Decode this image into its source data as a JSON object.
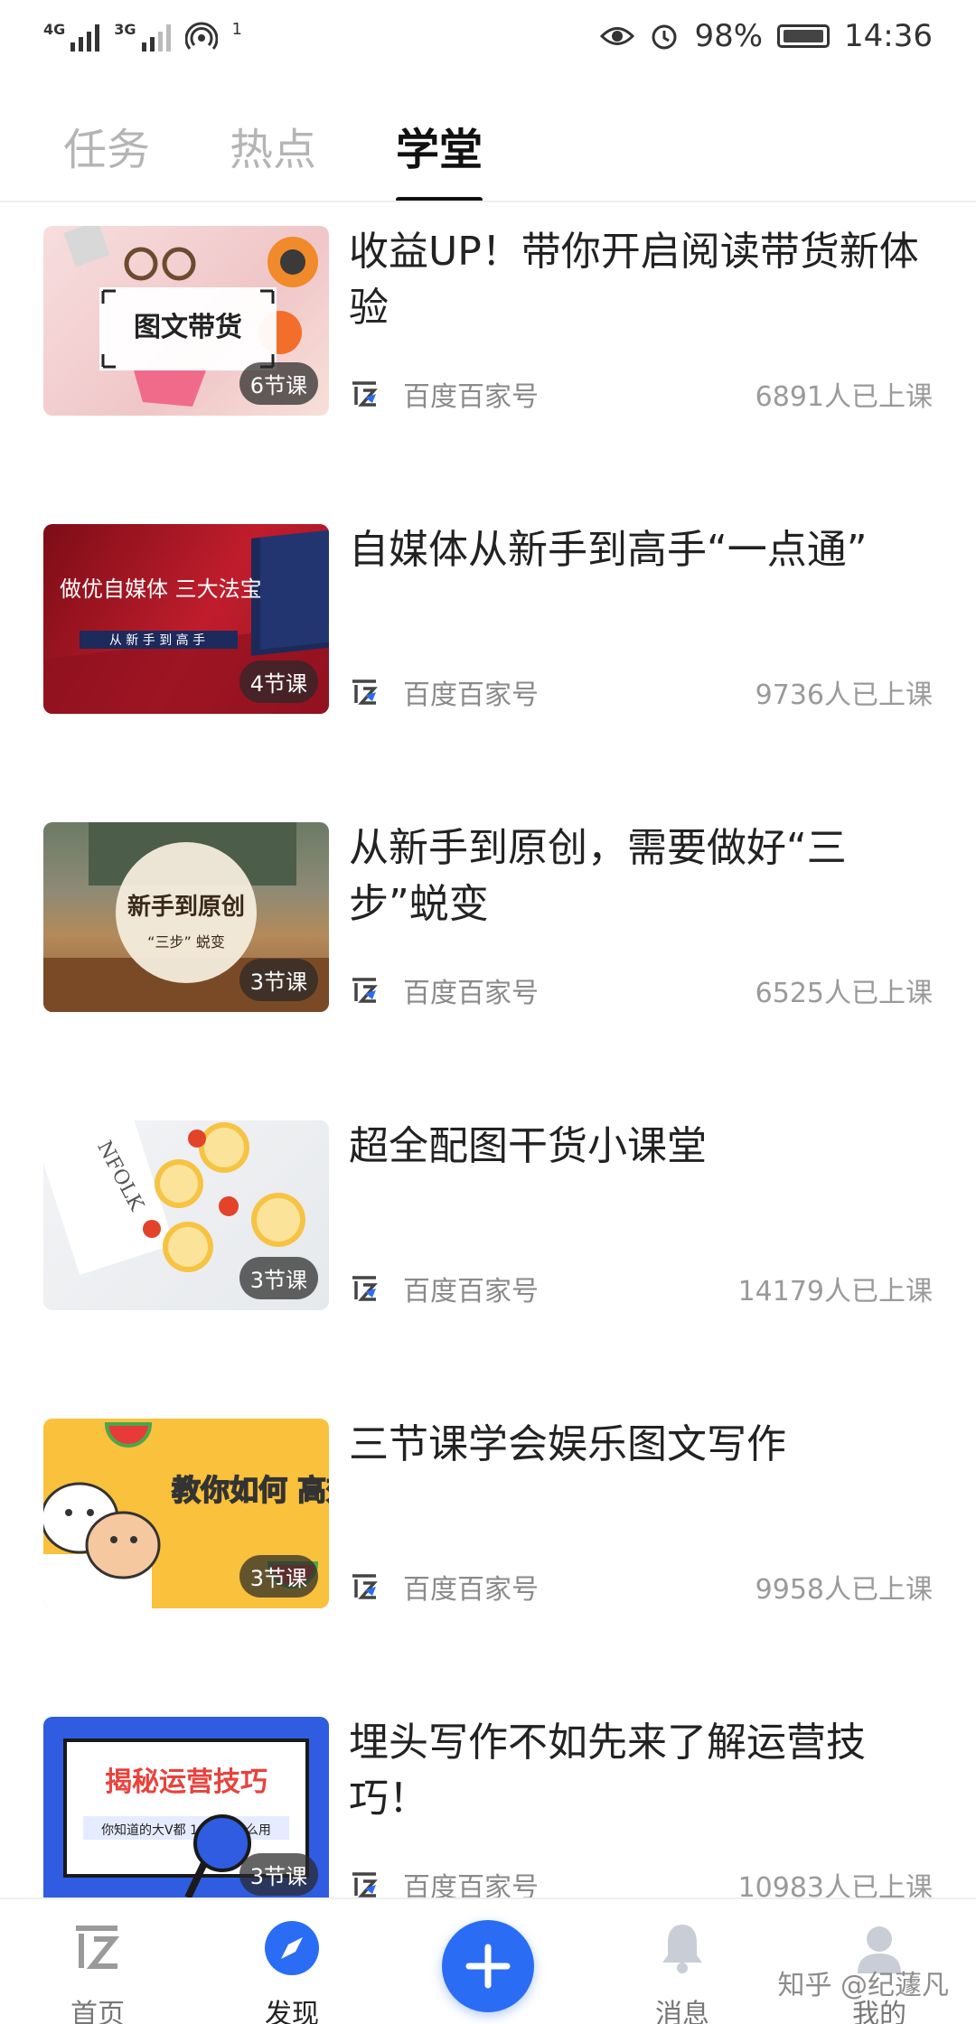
{
  "status_bar": {
    "net1": "4G",
    "net2": "3G",
    "hotspot_count": "1",
    "battery_percent": "98%",
    "time": "14:36"
  },
  "tabs": [
    {
      "label": "任务",
      "active": false
    },
    {
      "label": "热点",
      "active": false
    },
    {
      "label": "学堂",
      "active": true
    }
  ],
  "courses": [
    {
      "title": "收益UP！带你开启阅读带货新体验",
      "thumb_text": "图文带货",
      "thumb_subtext": "",
      "lessons": "6节课",
      "publisher": "百度百家号",
      "learners": "6891人已上课"
    },
    {
      "title": "自媒体从新手到高手“一点通”",
      "thumb_text": "做优自媒体 三大法宝",
      "thumb_subtext": "从 新 手 到 高 手",
      "lessons": "4节课",
      "publisher": "百度百家号",
      "learners": "9736人已上课"
    },
    {
      "title": "从新手到原创，需要做好“三步”蜕变",
      "thumb_text": "新手到原创",
      "thumb_subtext": "“三步” 蜕变",
      "lessons": "3节课",
      "publisher": "百度百家号",
      "learners": "6525人已上课"
    },
    {
      "title": "超全配图干货小课堂",
      "thumb_text": "NFOLK",
      "thumb_subtext": "",
      "lessons": "3节课",
      "publisher": "百度百家号",
      "learners": "14179人已上课"
    },
    {
      "title": "三节课学会娱乐图文写作",
      "thumb_text": "教你如何 高效吃瓜",
      "thumb_subtext": "",
      "lessons": "3节课",
      "publisher": "百度百家号",
      "learners": "9958人已上课"
    },
    {
      "title": "埋头写作不如先来了解运营技巧！",
      "thumb_text": "揭秘运营技巧",
      "thumb_subtext": "你知道的大V都 10W+ 这么用",
      "lessons": "3节课",
      "publisher": "百度百家号",
      "learners": "10983人已上课"
    }
  ],
  "bottom_nav": {
    "home": "首页",
    "discover": "发现",
    "messages": "消息",
    "mine": "我的"
  },
  "watermark": "知乎 @纪蘧凡",
  "colors": {
    "accent": "#2a6df4",
    "tab_active": "#111111",
    "tab_inactive": "#b5b5b5",
    "meta_text": "#9a9a9a"
  }
}
